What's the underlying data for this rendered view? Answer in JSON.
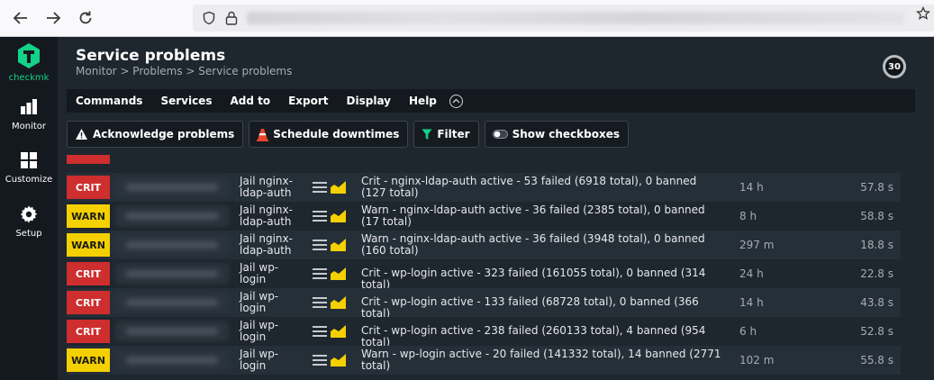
{
  "browser": {
    "back_icon": "arrow-left-icon",
    "forward_icon": "arrow-right-icon",
    "reload_icon": "reload-icon"
  },
  "sidebar": {
    "logo_text": "checkmk",
    "items": [
      {
        "label": "Monitor",
        "icon": "bar-chart-icon"
      },
      {
        "label": "Customize",
        "icon": "grid-icon"
      },
      {
        "label": "Setup",
        "icon": "gear-icon"
      }
    ]
  },
  "header": {
    "title": "Service problems",
    "breadcrumb": "Monitor > Problems > Service problems",
    "refresh_seconds": "30"
  },
  "menu": [
    "Commands",
    "Services",
    "Add to",
    "Export",
    "Display",
    "Help"
  ],
  "toolbar": {
    "acknowledge": "Acknowledge problems",
    "downtimes": "Schedule downtimes",
    "filter": "Filter",
    "checkboxes": "Show checkboxes"
  },
  "rows": [
    {
      "state": "CRIT",
      "service": "Jail nginx-ldap-auth",
      "output": "Crit - nginx-ldap-auth active - 53 failed (6918 total), 0 banned (127 total)",
      "age": "14 h",
      "checked": "57.8 s"
    },
    {
      "state": "WARN",
      "service": "Jail nginx-ldap-auth",
      "output": "Warn - nginx-ldap-auth active - 36 failed (2385 total), 0 banned (17 total)",
      "age": "8 h",
      "checked": "58.8 s"
    },
    {
      "state": "WARN",
      "service": "Jail nginx-ldap-auth",
      "output": "Warn - nginx-ldap-auth active - 36 failed (3948 total), 0 banned (160 total)",
      "age": "297 m",
      "checked": "18.8 s"
    },
    {
      "state": "CRIT",
      "service": "Jail wp-login",
      "output": "Crit - wp-login active - 323 failed (161055 total), 0 banned (314 total)",
      "age": "24 h",
      "checked": "22.8 s"
    },
    {
      "state": "CRIT",
      "service": "Jail wp-login",
      "output": "Crit - wp-login active - 133 failed (68728 total), 0 banned (366 total)",
      "age": "14 h",
      "checked": "43.8 s"
    },
    {
      "state": "CRIT",
      "service": "Jail wp-login",
      "output": "Crit - wp-login active - 238 failed (260133 total), 4 banned (954 total)",
      "age": "6 h",
      "checked": "52.8 s"
    },
    {
      "state": "WARN",
      "service": "Jail wp-login",
      "output": "Warn - wp-login active - 20 failed (141332 total), 14 banned (2771 total)",
      "age": "102 m",
      "checked": "55.8 s"
    }
  ],
  "colors": {
    "crit": "#cf2e2e",
    "warn": "#f5d000",
    "brand": "#13d389"
  }
}
